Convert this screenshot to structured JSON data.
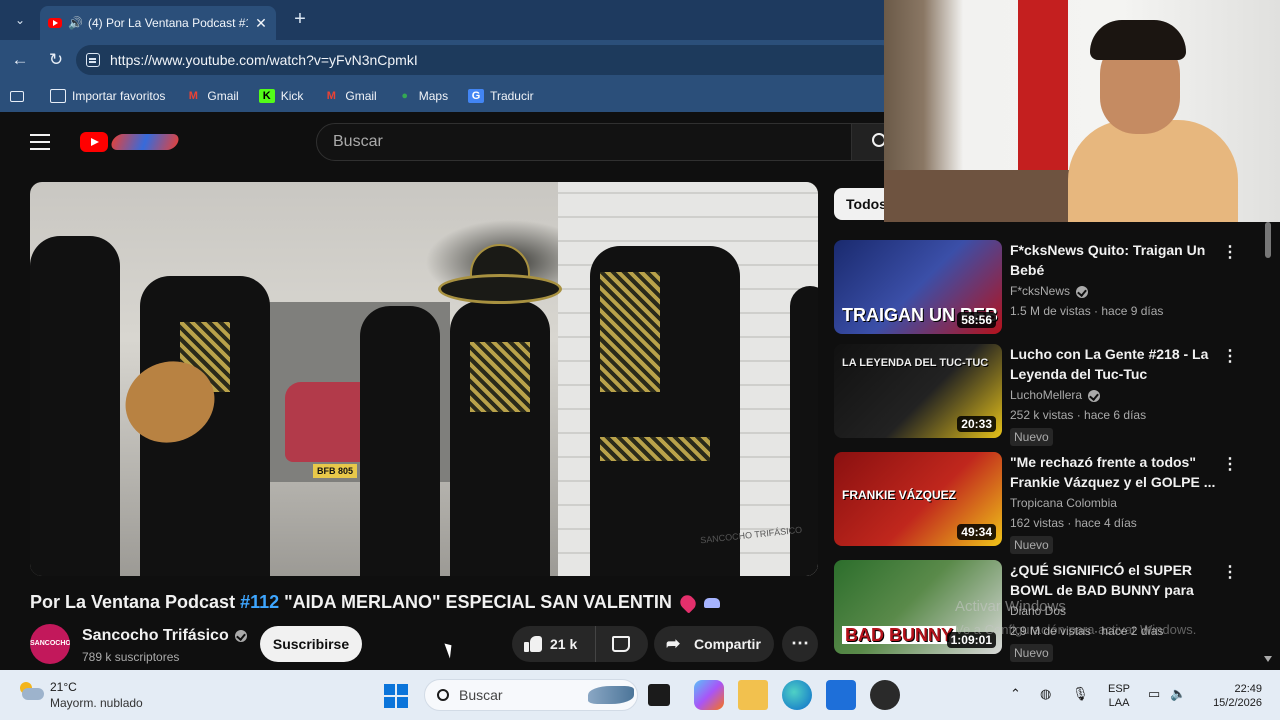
{
  "browser": {
    "tab_title": "(4) Por La Ventana Podcast #1",
    "tab_close": "✕",
    "new_tab": "+",
    "url": "https://www.youtube.com/watch?v=yFvN3nCpmkI",
    "bookmarks": [
      {
        "label": "Importar favoritos",
        "icon": "import-icon"
      },
      {
        "label": "Gmail",
        "icon": "gmail-icon"
      },
      {
        "label": "Kick",
        "icon": "kick-icon"
      },
      {
        "label": "Gmail",
        "icon": "gmail-icon"
      },
      {
        "label": "Maps",
        "icon": "maps-icon"
      },
      {
        "label": "Traducir",
        "icon": "translate-icon"
      }
    ]
  },
  "youtube": {
    "search_placeholder": "Buscar",
    "video": {
      "plate": "BFB 805",
      "watermark": "SANCOCHO TRIFÁSICO",
      "title_prefix": "Por La Ventana Podcast ",
      "title_tag": "#112",
      "title_rest": " \"AIDA MERLANO\" ESPECIAL SAN VALENTIN"
    },
    "channel": {
      "avatar_text": "SANCOCHO TRIFÁSICO",
      "name": "Sancocho Trifásico",
      "subscribers": "789 k suscriptores",
      "subscribe_label": "Suscribirse"
    },
    "actions": {
      "likes": "21 k",
      "share_label": "Compartir",
      "more": "⋯"
    },
    "chip": "Todos",
    "recommendations": [
      {
        "title": "F*cksNews Quito: Traigan Un Bebé",
        "channel": "F*cksNews",
        "verified": true,
        "meta": "1.5 M de vistas · hace 9 días",
        "duration": "58:56",
        "thumb_text": "TRAIGAN UN BEB",
        "badge": "",
        "colors": [
          "#1a2a6e",
          "#b5121b"
        ]
      },
      {
        "title": "Lucho con La Gente #218 - La Leyenda del Tuc-Tuc",
        "channel": "LuchoMellera",
        "verified": true,
        "meta": "252 k vistas · hace 6 días",
        "duration": "20:33",
        "thumb_text": "LA LEYENDA DEL TUC-TUC",
        "badge": "Nuevo",
        "colors": [
          "#111111",
          "#e6c21a"
        ]
      },
      {
        "title": "\"Me rechazó frente a todos\" Frankie Vázquez y el GOLPE ...",
        "channel": "Tropicana Colombia",
        "verified": false,
        "meta": "162 vistas · hace 4 días",
        "duration": "49:34",
        "thumb_text": "FRANKIE VÁZQUEZ",
        "badge": "Nuevo",
        "colors": [
          "#8a1010",
          "#f0c419"
        ]
      },
      {
        "title": "¿QUÉ SIGNIFICÓ el SUPER BOWL de BAD BUNNY para los...",
        "channel": "Diario Dos",
        "verified": false,
        "meta": "2.9 M de vistas · hace 2 días",
        "duration": "1:09:01",
        "thumb_text": "BAD BUNNY",
        "badge": "Nuevo",
        "colors": [
          "#2c6e2c",
          "#ffffff"
        ]
      }
    ],
    "activate_windows": "Activar Windows",
    "activate_windows_sub": "Ve a Configuración para activar Windows."
  },
  "taskbar": {
    "temperature": "21°C",
    "condition": "Mayorm. nublado",
    "search_placeholder": "Buscar",
    "language_top": "ESP",
    "language_bottom": "LAA",
    "time": "22:49",
    "date": "15/2/2026"
  }
}
